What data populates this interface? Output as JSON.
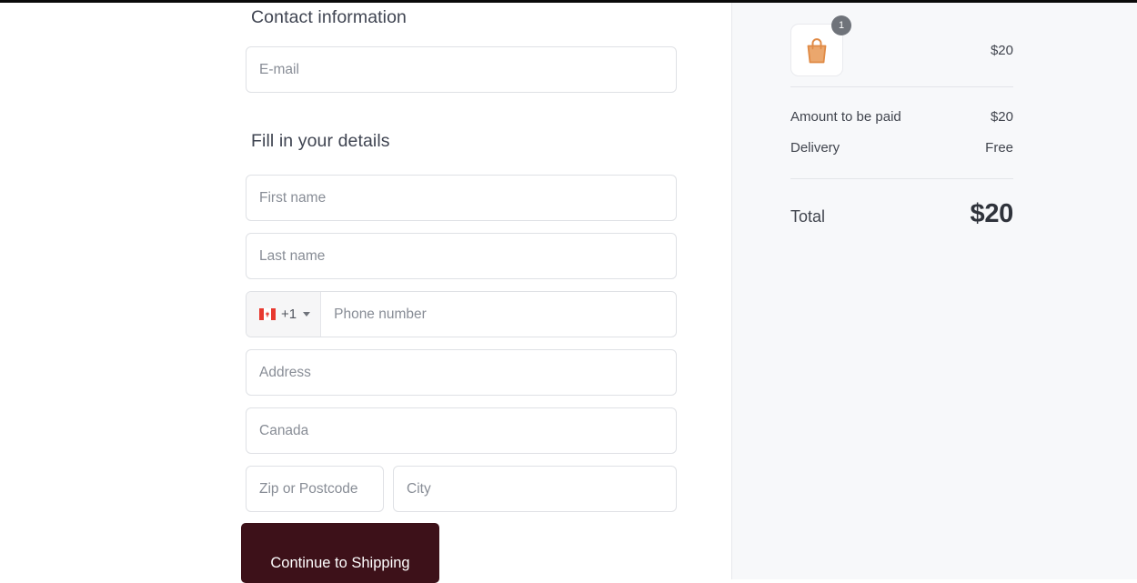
{
  "checkout": {
    "contact": {
      "heading": "Contact information",
      "email_placeholder": "E-mail",
      "email_value": ""
    },
    "details": {
      "heading": "Fill in your details",
      "first_name_placeholder": "First name",
      "first_name_value": "",
      "last_name_placeholder": "Last name",
      "last_name_value": "",
      "phone": {
        "country_flag": "canada-flag-icon",
        "dial_code": "+1",
        "dropdown_icon": "chevron-down-icon",
        "placeholder": "Phone number",
        "value": ""
      },
      "address_placeholder": "Address",
      "address_value": "",
      "country_value": "Canada",
      "zip_placeholder": "Zip or Postcode",
      "zip_value": "",
      "city_placeholder": "City",
      "city_value": ""
    },
    "submit_label": "Continue to Shipping"
  },
  "summary": {
    "product": {
      "icon": "shopping-bag-icon",
      "quantity_badge": "1",
      "price": "$20"
    },
    "lines": [
      {
        "label": "Amount to be paid",
        "value": "$20"
      },
      {
        "label": "Delivery",
        "value": "Free"
      }
    ],
    "total": {
      "label": "Total",
      "value": "$20"
    }
  },
  "colors": {
    "button": "#3d1119",
    "panel_bg": "#f7f8fa",
    "badge": "#6f737a",
    "bag_icon": "#e49354",
    "flag_red": "#e8392f"
  }
}
